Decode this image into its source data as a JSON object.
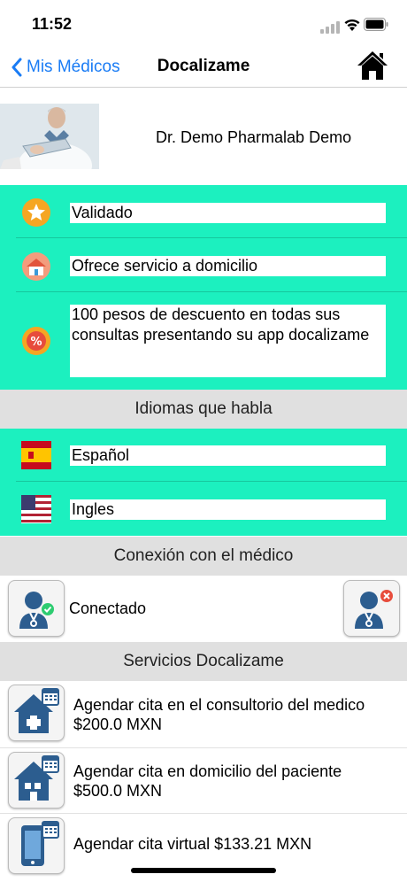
{
  "status_bar": {
    "time": "11:52"
  },
  "nav": {
    "back_label": "Mis Médicos",
    "title": "Docalizame"
  },
  "doctor": {
    "name": "Dr. Demo Pharmalab Demo"
  },
  "features": [
    {
      "icon": "star-icon",
      "text": "Validado"
    },
    {
      "icon": "house-icon",
      "text": "Ofrece servicio a domicilio"
    },
    {
      "icon": "discount-icon",
      "text": "100 pesos de descuento en todas sus consultas presentando su app docalizame"
    }
  ],
  "languages_section": {
    "title": "Idiomas que habla"
  },
  "languages": [
    {
      "icon": "spain-flag-icon",
      "text": "Español"
    },
    {
      "icon": "usa-flag-icon",
      "text": "Ingles"
    }
  ],
  "connection_section": {
    "title": "Conexión con el médico",
    "status": "Conectado"
  },
  "services_section": {
    "title": "Servicios Docalizame"
  },
  "services": [
    {
      "icon": "clinic-appointment-icon",
      "line1": "Agendar cita en el consultorio del medico",
      "line2": "$200.0 MXN"
    },
    {
      "icon": "home-appointment-icon",
      "line1": "Agendar cita en domicilio del paciente",
      "line2": "$500.0 MXN"
    },
    {
      "icon": "virtual-appointment-icon",
      "line1": "Agendar cita virtual $133.21 MXN",
      "line2": ""
    }
  ],
  "colors": {
    "accent_green": "#1cf0bf",
    "link_blue": "#1a7cf5",
    "section_gray": "#e0e0e0"
  }
}
